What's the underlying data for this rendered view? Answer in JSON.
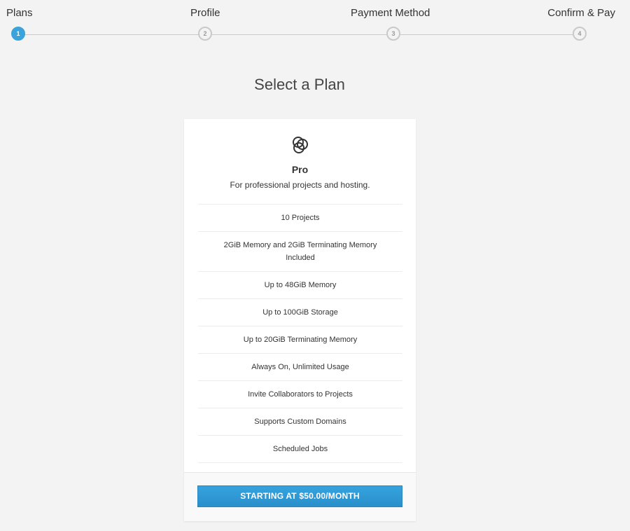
{
  "stepper": {
    "steps": [
      {
        "label": "Plans",
        "number": "1",
        "active": true
      },
      {
        "label": "Profile",
        "number": "2",
        "active": false
      },
      {
        "label": "Payment Method",
        "number": "3",
        "active": false
      },
      {
        "label": "Confirm & Pay",
        "number": "4",
        "active": false
      }
    ],
    "active_color": "#3aa3dc"
  },
  "heading": "Select a Plan",
  "plan": {
    "icon": "overlapping-circles-icon",
    "name": "Pro",
    "description": "For professional projects and hosting.",
    "features": [
      "10 Projects",
      "2GiB Memory and 2GiB Terminating Memory Included",
      "Up to 48GiB Memory",
      "Up to 100GiB Storage",
      "Up to 20GiB Terminating Memory",
      "Always On, Unlimited Usage",
      "Invite Collaborators to Projects",
      "Supports Custom Domains",
      "Scheduled Jobs"
    ],
    "cta_label": "STARTING AT $50.00/MONTH",
    "cta_color": "#35a3de"
  }
}
